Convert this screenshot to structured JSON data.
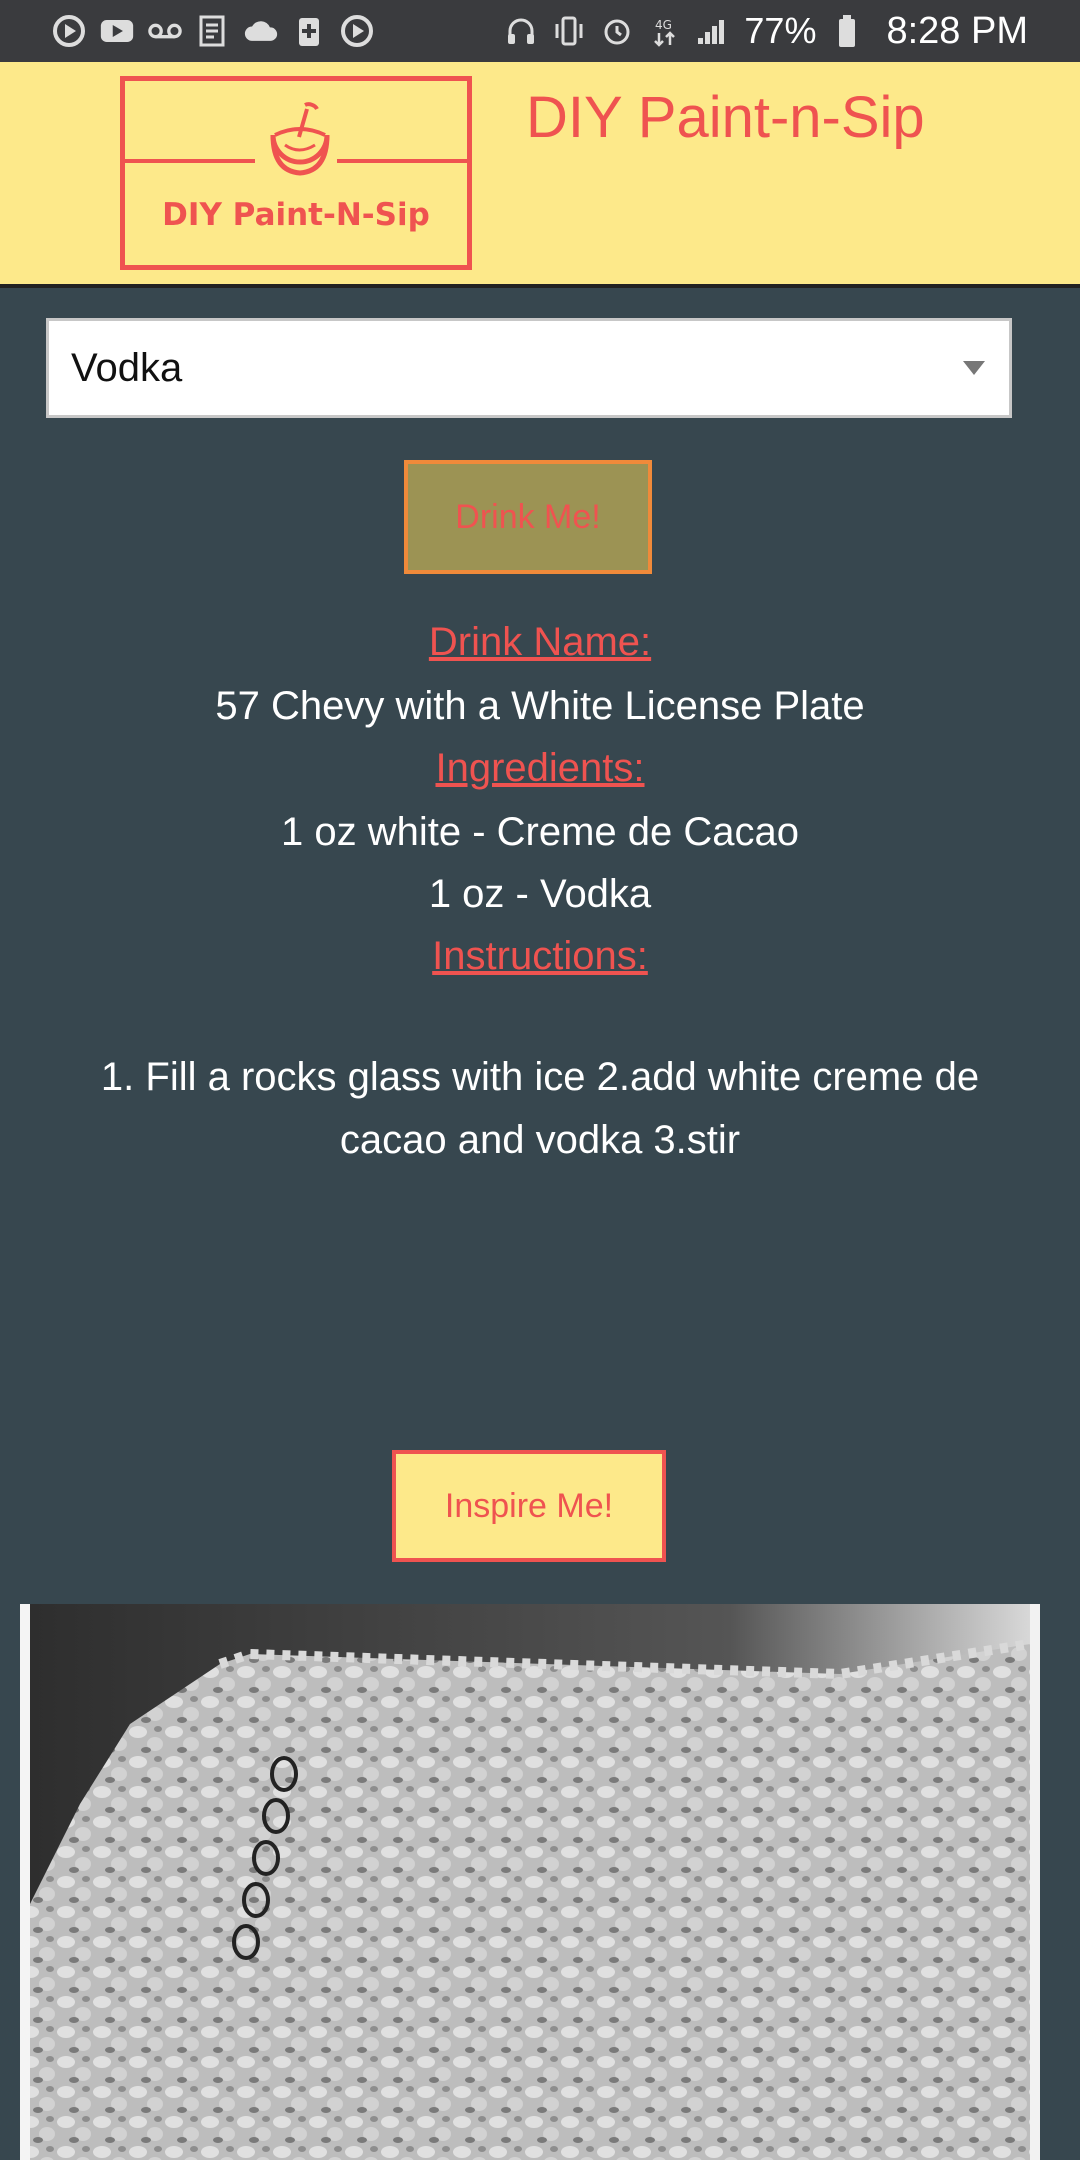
{
  "status_bar": {
    "battery_percent": "77%",
    "time": "8:28 PM",
    "left_icons": [
      "play-circle-icon",
      "youtube-icon",
      "voicemail-icon",
      "news-icon",
      "cloud-icon",
      "plus-box-icon",
      "play-circle-icon"
    ],
    "right_icons": [
      "headphones-icon",
      "vibrate-icon",
      "alarm-icon",
      "data-4g-icon",
      "signal-icon",
      "battery-icon"
    ]
  },
  "header": {
    "logo_text": "DIY Paint-N-Sip",
    "title": "DIY Paint-n-Sip",
    "bg_color": "#fde98a",
    "accent_color": "#ef5350"
  },
  "select": {
    "value": "Vodka"
  },
  "drink_button": {
    "label": "Drink Me!"
  },
  "drink": {
    "name_label": "Drink Name:",
    "name": "57 Chevy with a White License Plate",
    "ingredients_label": "Ingredients:",
    "ingredients": [
      "1 oz white - Creme de Cacao",
      "1 oz - Vodka"
    ],
    "instructions_label": "Instructions:",
    "instructions": "1. Fill a rocks glass with ice 2.add white creme de cacao and vodka 3.stir"
  },
  "inspire_button": {
    "label": "Inspire Me!"
  },
  "art": {
    "description_icon": "lace-artwork-image"
  }
}
